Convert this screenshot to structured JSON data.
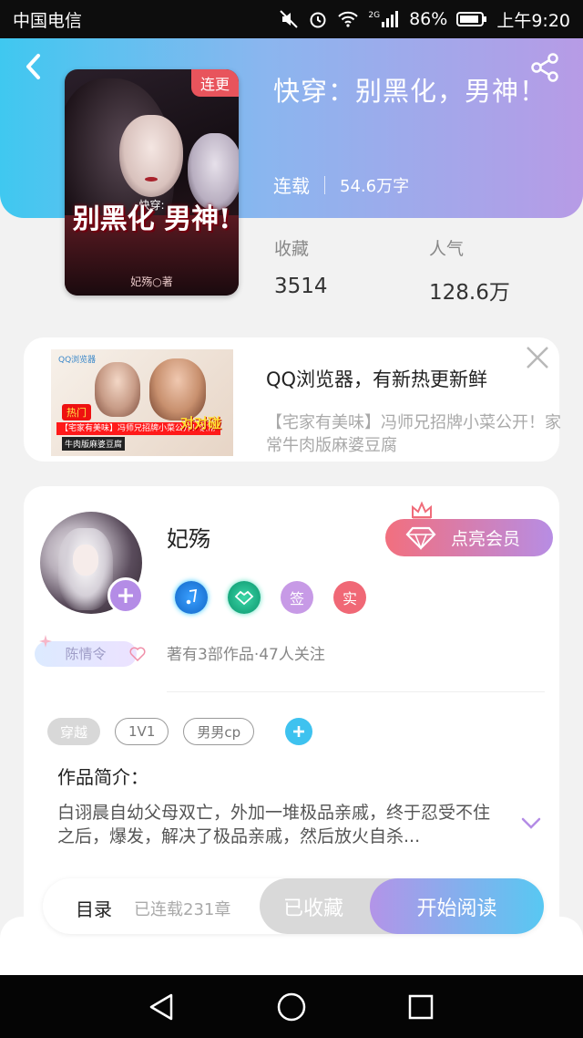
{
  "status_bar": {
    "carrier": "中国电信",
    "network": "2G",
    "battery": "86%",
    "time": "上午9:20"
  },
  "book": {
    "title": "快穿：别黑化，男神！",
    "badge": "连更",
    "status": "连载",
    "word_count": "54.6万字",
    "cover_small_text": "快穿:",
    "cover_title": "别黑化 男神!",
    "cover_author": "妃殇○著"
  },
  "stats": [
    {
      "label": "收藏",
      "value": "3514"
    },
    {
      "label": "人气",
      "value": "128.6万"
    }
  ],
  "ad": {
    "title": "QQ浏览器，有新热更新鲜",
    "description": "【宅家有美味】冯师兄招牌小菜公开！家常牛肉版麻婆豆腐",
    "thumb_logo": "QQ浏览器",
    "thumb_hot": "热门",
    "thumb_strip": "【宅家有美味】冯师兄招牌小菜公开！家常",
    "thumb_strip2": "牛肉版麻婆豆腐",
    "thumb_big": "对对碰"
  },
  "author": {
    "name": "妃殇",
    "frame_tag": "陈情令",
    "vip_label": "点亮会员",
    "badges": [
      "",
      "",
      "签",
      "实"
    ],
    "stats_text": "著有3部作品·47人关注"
  },
  "tags": [
    "穿越",
    "1V1",
    "男男cp"
  ],
  "intro": {
    "label": "作品简介：",
    "text": "白诩晨自幼父母双亡，外加一堆极品亲戚，终于忍受不住之后，爆发，解决了极品亲戚，然后放火自杀..."
  },
  "action_bar": {
    "toc_label": "目录",
    "toc_count": "已连载231章",
    "collected_label": "已收藏",
    "read_label": "开始阅读"
  },
  "colors": {
    "accent_start": "#3fc8f0",
    "accent_end": "#b79be6",
    "badge_red": "#e8545c",
    "vip_pink": "#f26f7e"
  }
}
